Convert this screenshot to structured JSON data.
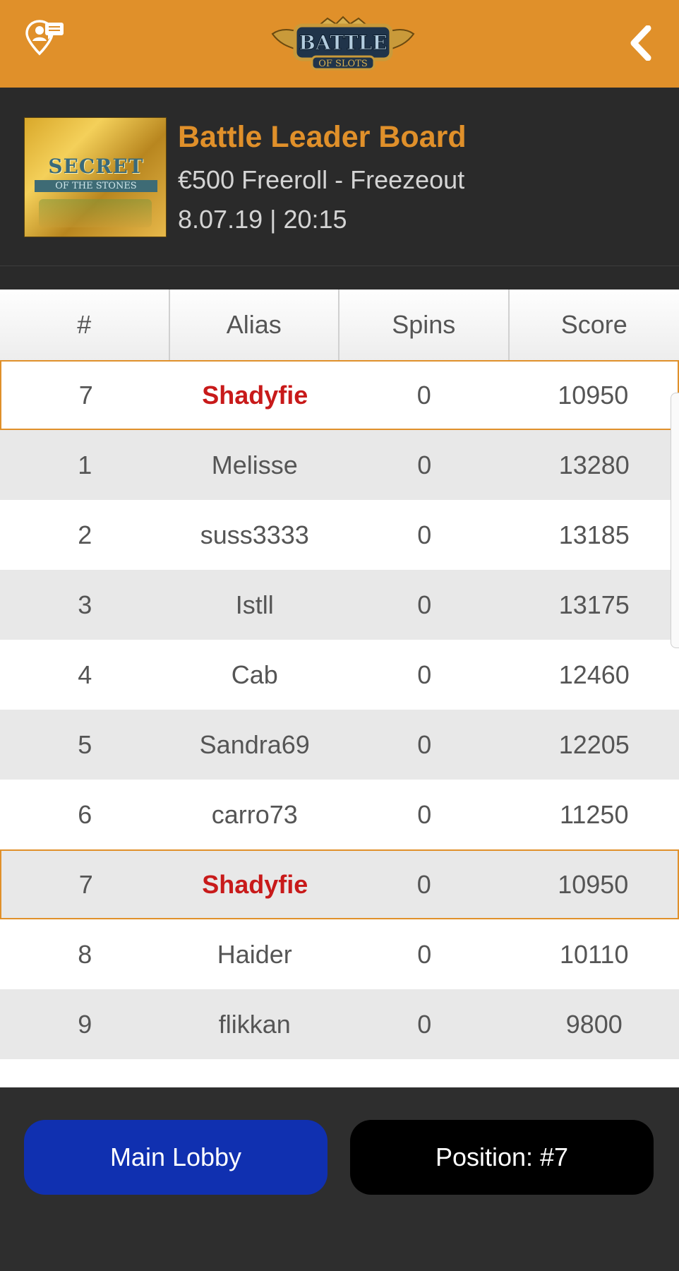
{
  "app": {
    "logo_text_main": "BATTLE",
    "logo_text_sub": "OF SLOTS"
  },
  "header": {
    "title": "Battle Leader Board",
    "subtitle": "€500 Freeroll - Freezeout",
    "datetime": "8.07.19 | 20:15",
    "thumbnail_title": "SECRET",
    "thumbnail_subtitle": "OF THE STONES"
  },
  "table": {
    "columns": [
      "#",
      "Alias",
      "Spins",
      "Score"
    ],
    "my_row": {
      "rank": "7",
      "alias": "Shadyfie",
      "spins": "0",
      "score": "10950"
    },
    "rows": [
      {
        "rank": "1",
        "alias": "Melisse",
        "spins": "0",
        "score": "13280"
      },
      {
        "rank": "2",
        "alias": "suss3333",
        "spins": "0",
        "score": "13185"
      },
      {
        "rank": "3",
        "alias": "Istll",
        "spins": "0",
        "score": "13175"
      },
      {
        "rank": "4",
        "alias": "Cab",
        "spins": "0",
        "score": "12460"
      },
      {
        "rank": "5",
        "alias": "Sandra69",
        "spins": "0",
        "score": "12205"
      },
      {
        "rank": "6",
        "alias": "carro73",
        "spins": "0",
        "score": "11250"
      },
      {
        "rank": "7",
        "alias": "Shadyfie",
        "spins": "0",
        "score": "10950"
      },
      {
        "rank": "8",
        "alias": "Haider",
        "spins": "0",
        "score": "10110"
      },
      {
        "rank": "9",
        "alias": "flikkan",
        "spins": "0",
        "score": "9800"
      }
    ]
  },
  "footer": {
    "main_lobby_label": "Main Lobby",
    "position_label": "Position: #7"
  },
  "colors": {
    "accent": "#e0902a",
    "header_bg": "#2a2a2a",
    "highlight_alias": "#c81a1a",
    "lobby_button": "#1030b0",
    "position_button": "#000000"
  },
  "icons": {
    "left": "location-pin-chat-icon",
    "right": "chevron-left-icon"
  }
}
